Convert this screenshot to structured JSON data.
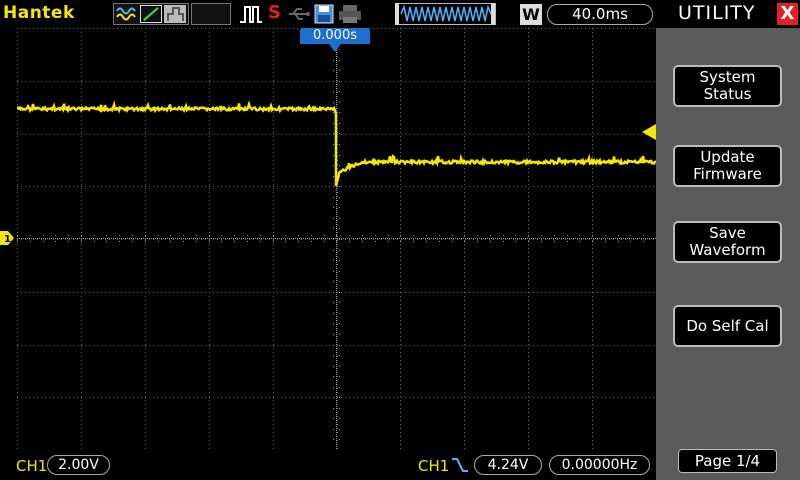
{
  "brand": "Hantek",
  "colors": {
    "trace": "#f5e60a",
    "trigger_label_bg": "#1f6fd0",
    "close_button": "#e0202a",
    "menu_background": "#5a5a5a"
  },
  "topbar": {
    "mode_icons": [
      "waveform-icon",
      "slope-icon",
      "persistence-icon"
    ],
    "status_s": "S",
    "acq_mode": "W",
    "timebase": "40.0ms"
  },
  "scope": {
    "trigger_position": "0.000s",
    "channel_marker": "1"
  },
  "bottombar": {
    "ch1_label": "CH1",
    "ch1_scale": "2.00V",
    "trigger_source": "CH1",
    "trigger_level": "4.24V",
    "frequency": "0.00000Hz"
  },
  "menu": {
    "title": "UTILITY",
    "close": "X",
    "items": [
      {
        "label": "System\nStatus"
      },
      {
        "label": "Update\nFirmware"
      },
      {
        "label": "Save\nWaveform"
      },
      {
        "label": "Do Self Cal"
      }
    ],
    "page": "Page 1/4"
  }
}
